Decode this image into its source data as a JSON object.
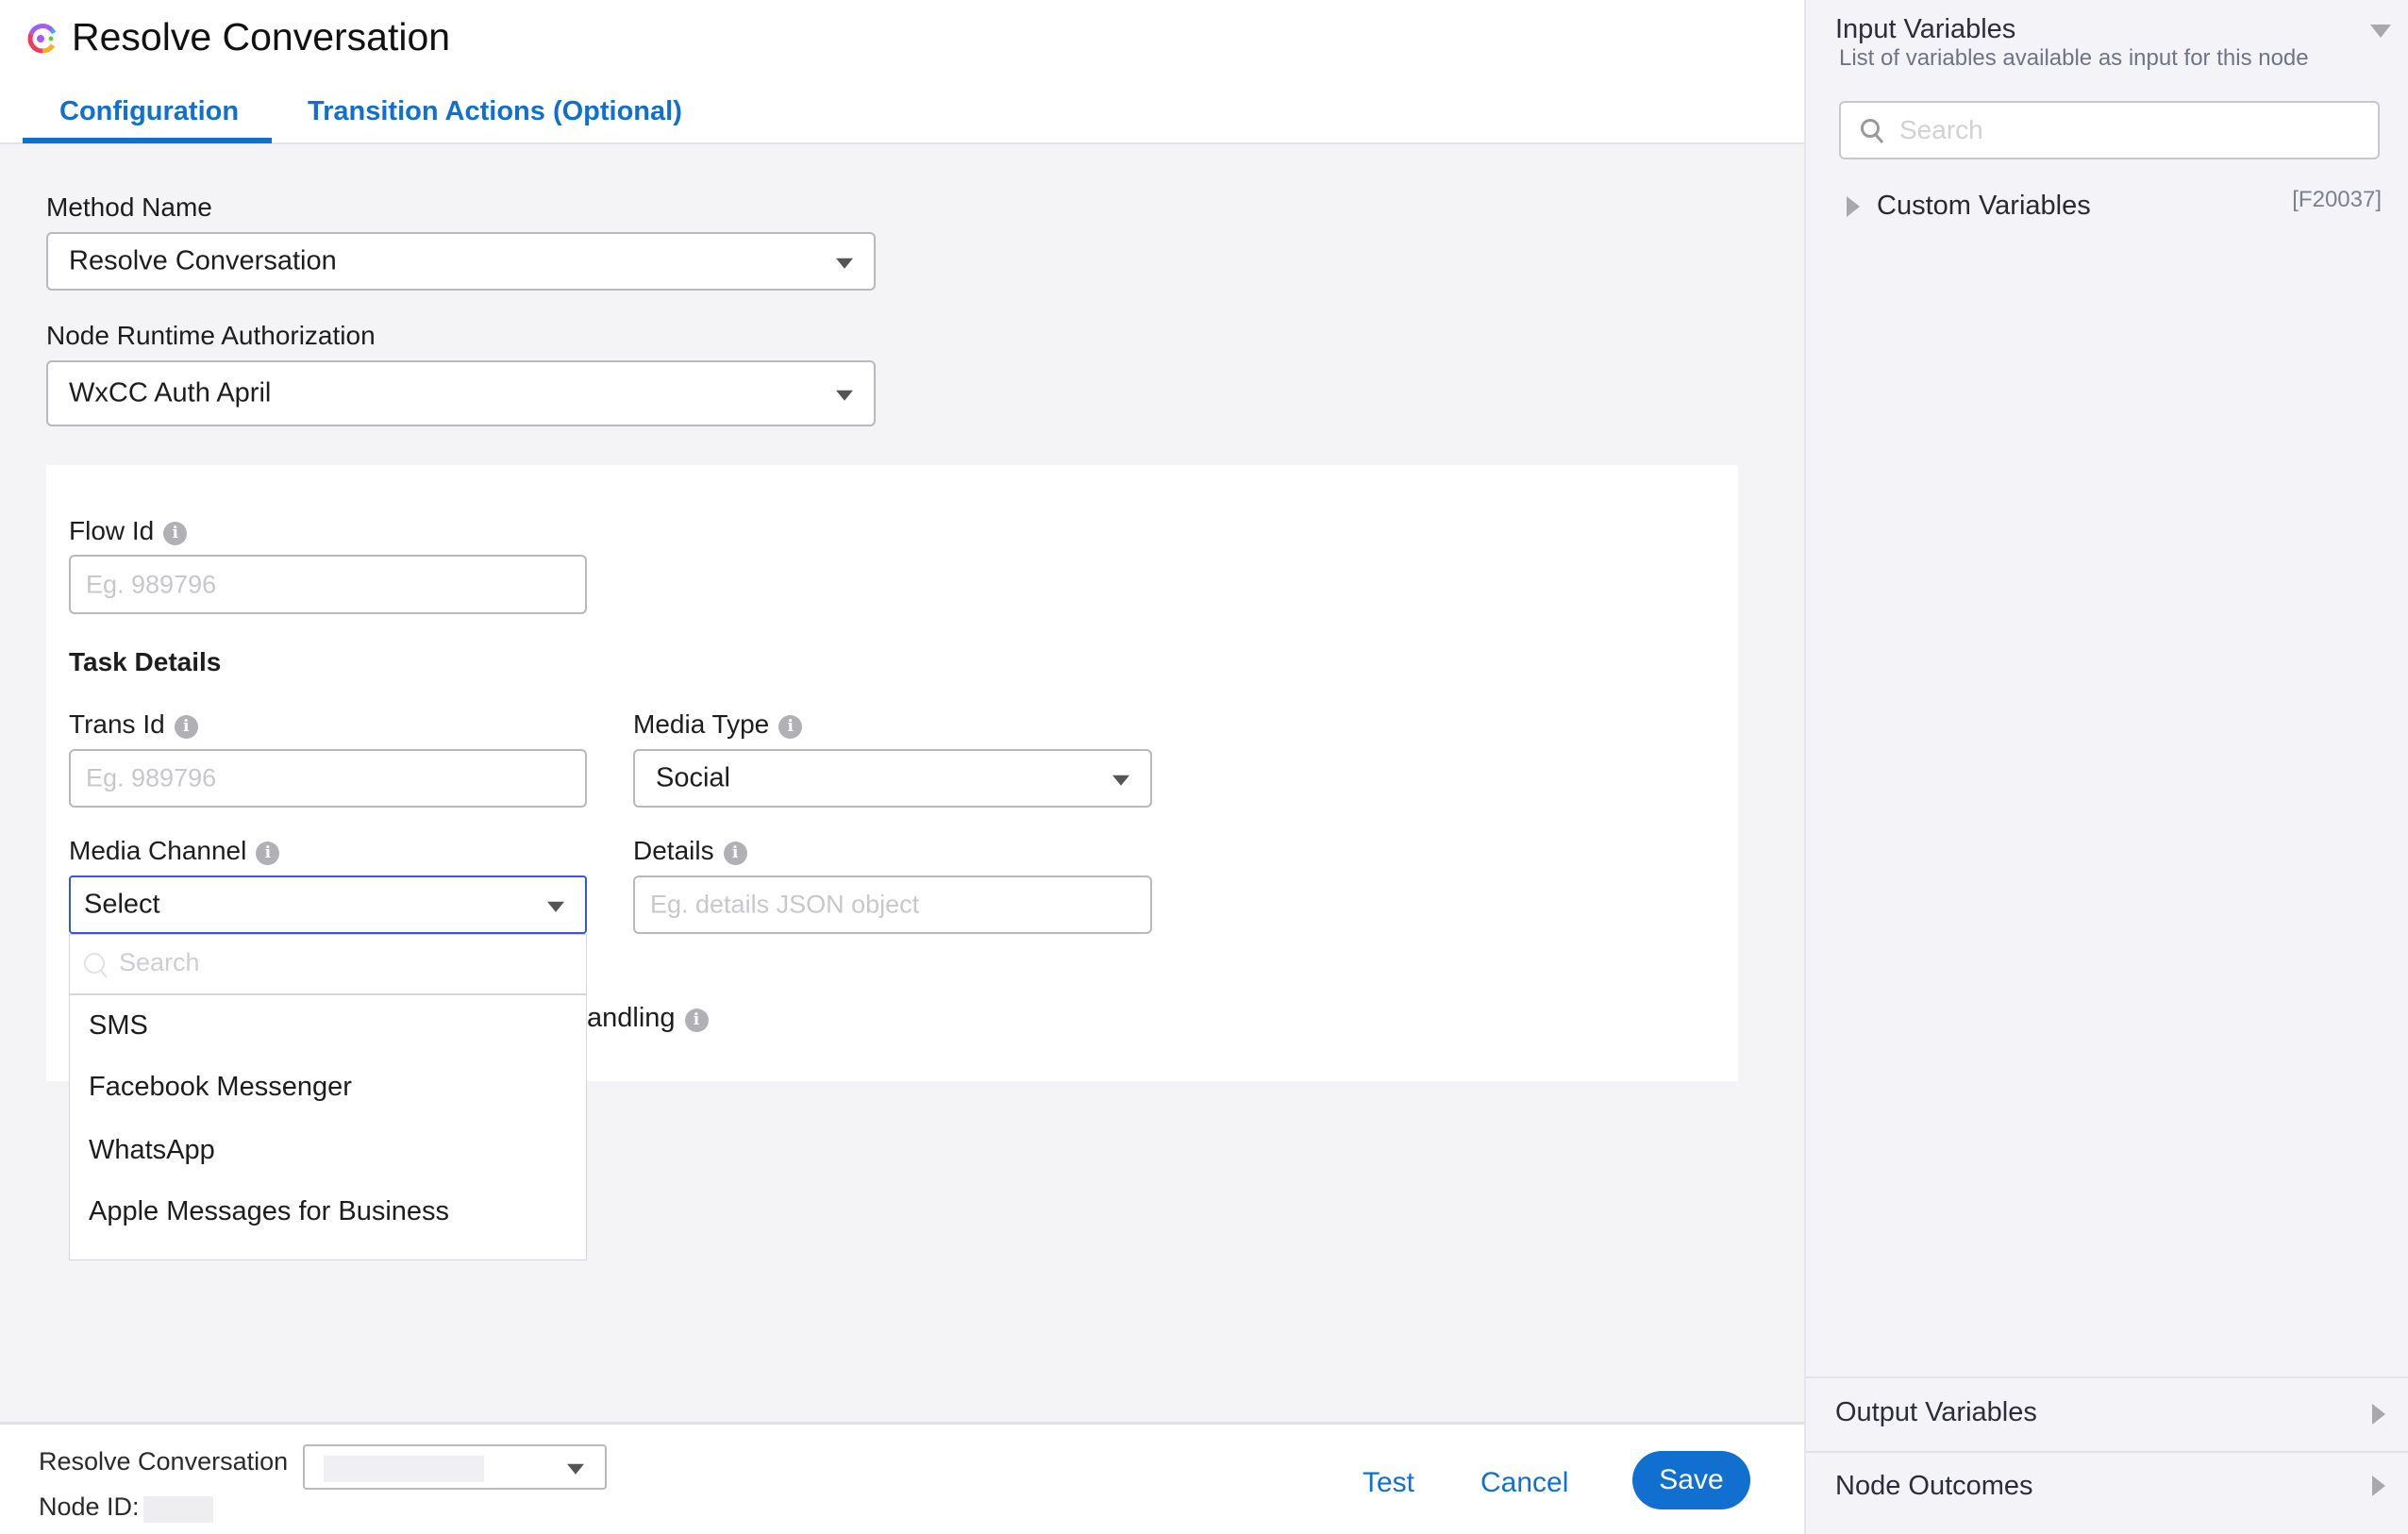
{
  "header": {
    "title": "Resolve Conversation",
    "tabs": [
      {
        "label": "Configuration",
        "active": true
      },
      {
        "label": "Transition Actions (Optional)",
        "active": false
      }
    ]
  },
  "form": {
    "method_name": {
      "label": "Method Name",
      "value": "Resolve Conversation"
    },
    "node_runtime_auth": {
      "label": "Node Runtime Authorization",
      "value": "WxCC Auth April"
    },
    "flow_id": {
      "label": "Flow Id",
      "placeholder": "Eg. 989796"
    },
    "task_details_heading": "Task Details",
    "trans_id": {
      "label": "Trans Id",
      "placeholder": "Eg. 989796"
    },
    "media_type": {
      "label": "Media Type",
      "value": "Social"
    },
    "media_channel": {
      "label": "Media Channel",
      "value": "Select",
      "search_placeholder": "Search",
      "options": [
        "SMS",
        "Facebook Messenger",
        "WhatsApp",
        "Apple Messages for Business"
      ]
    },
    "details": {
      "label": "Details",
      "placeholder": "Eg. details JSON object"
    },
    "partial_label": "andling"
  },
  "footer": {
    "node_label": "Resolve Conversation",
    "node_id_label": "Node ID:",
    "test": "Test",
    "cancel": "Cancel",
    "save": "Save"
  },
  "right_panel": {
    "input_variables": {
      "title": "Input Variables",
      "subtitle": "List of variables available as input for this node",
      "search_placeholder": "Search",
      "groups": [
        {
          "label": "Custom Variables",
          "code": "[F20037]"
        }
      ]
    },
    "output_variables": "Output Variables",
    "node_outcomes": "Node Outcomes"
  },
  "colors": {
    "accent": "#1170cf",
    "focus_border": "#3a55dd"
  }
}
